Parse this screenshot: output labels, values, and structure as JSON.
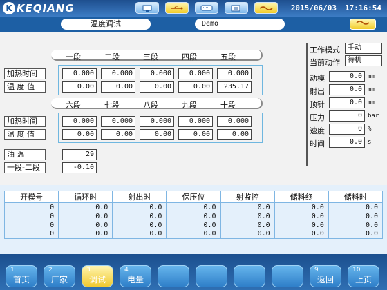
{
  "header": {
    "brand": "KEQIANG",
    "brand_mark": "K",
    "icons": [
      {
        "name": "screen-icon",
        "color": "blue"
      },
      {
        "name": "usb-icon",
        "color": "yellow"
      },
      {
        "name": "keyboard-icon",
        "color": "blue"
      },
      {
        "name": "book-icon",
        "color": "blue"
      },
      {
        "name": "handshake-icon",
        "color": "yellow"
      }
    ],
    "date": "2015/06/03",
    "time": "17:16:54"
  },
  "titlebar": {
    "page_title": "温度调试",
    "mold_name": "Demo"
  },
  "group1": {
    "columns": [
      "一段",
      "二段",
      "三段",
      "四段",
      "五段"
    ],
    "row_labels": [
      "加热时间",
      "温 度 值"
    ],
    "heat_time": [
      "0.000",
      "0.000",
      "0.000",
      "0.000",
      "0.000"
    ],
    "temperature": [
      "0.00",
      "0.00",
      "0.00",
      "0.00",
      "235.17"
    ]
  },
  "group2": {
    "columns": [
      "六段",
      "七段",
      "八段",
      "九段",
      "十段"
    ],
    "row_labels": [
      "加热时间",
      "温 度 值"
    ],
    "heat_time": [
      "0.000",
      "0.000",
      "0.000",
      "0.000",
      "0.000"
    ],
    "temperature": [
      "0.00",
      "0.00",
      "0.00",
      "0.00",
      "0.00"
    ]
  },
  "extra": {
    "oil_temp_label": "油 温",
    "oil_temp_value": "29",
    "diff_label": "一段-二段",
    "diff_value": "-0.10"
  },
  "status": {
    "mode_label": "工作模式",
    "mode_value": "手动",
    "action_label": "当前动作",
    "action_value": "待机",
    "items": [
      {
        "label": "动模",
        "value": "0.0",
        "unit": "mm"
      },
      {
        "label": "射出",
        "value": "0.0",
        "unit": "mm"
      },
      {
        "label": "顶针",
        "value": "0.0",
        "unit": "mm"
      },
      {
        "label": "压力",
        "value": "0",
        "unit": "bar"
      },
      {
        "label": "速度",
        "value": "0",
        "unit": "%"
      },
      {
        "label": "时间",
        "value": "0.0",
        "unit": "s"
      }
    ]
  },
  "table": {
    "headers": [
      "开模号",
      "循环时",
      "射出时",
      "保压位",
      "射监控",
      "储料终",
      "储料时"
    ],
    "rows": [
      [
        "0",
        "0.0",
        "0.0",
        "0.0",
        "0.0",
        "0.0",
        "0.0"
      ],
      [
        "0",
        "0.0",
        "0.0",
        "0.0",
        "0.0",
        "0.0",
        "0.0"
      ],
      [
        "0",
        "0.0",
        "0.0",
        "0.0",
        "0.0",
        "0.0",
        "0.0"
      ],
      [
        "0",
        "0.0",
        "0.0",
        "0.0",
        "0.0",
        "0.0",
        "0.0"
      ]
    ]
  },
  "footer": {
    "buttons": [
      {
        "num": "1",
        "label": "首页"
      },
      {
        "num": "2",
        "label": "厂家"
      },
      {
        "num": "3",
        "label": "调试"
      },
      {
        "num": "4",
        "label": "电量"
      },
      {
        "num": "",
        "label": ""
      },
      {
        "num": "",
        "label": ""
      },
      {
        "num": "",
        "label": ""
      },
      {
        "num": "",
        "label": ""
      },
      {
        "num": "9",
        "label": "返回"
      },
      {
        "num": "10",
        "label": "上页"
      }
    ],
    "active_index": 2
  }
}
